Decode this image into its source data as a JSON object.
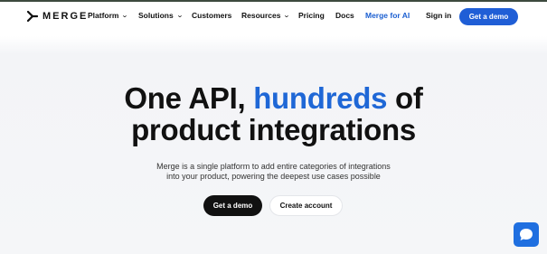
{
  "colors": {
    "accent": "#1f5ed6",
    "headline_highlight": "#1f67d6",
    "dark_button": "#111111",
    "chat_widget": "#1f6fe0"
  },
  "nav": {
    "logo_text": "MERGE",
    "items": [
      {
        "label": "Platform",
        "has_dropdown": true
      },
      {
        "label": "Solutions",
        "has_dropdown": true
      },
      {
        "label": "Customers",
        "has_dropdown": false
      },
      {
        "label": "Resources",
        "has_dropdown": true
      },
      {
        "label": "Pricing",
        "has_dropdown": false
      },
      {
        "label": "Docs",
        "has_dropdown": false
      },
      {
        "label": "Merge for AI",
        "has_dropdown": false
      }
    ],
    "sign_in": "Sign in",
    "get_demo": "Get a demo"
  },
  "hero": {
    "title_part1": "One API, ",
    "title_highlight": "hundreds",
    "title_part2": " of",
    "title_line2": "product integrations",
    "subtitle_line1": "Merge is a single platform to add entire categories of integrations",
    "subtitle_line2": "into your product, powering the deepest use cases possible",
    "primary_cta": "Get a demo",
    "secondary_cta": "Create account"
  },
  "chat_widget": {
    "icon": "chat-bubble-icon"
  }
}
